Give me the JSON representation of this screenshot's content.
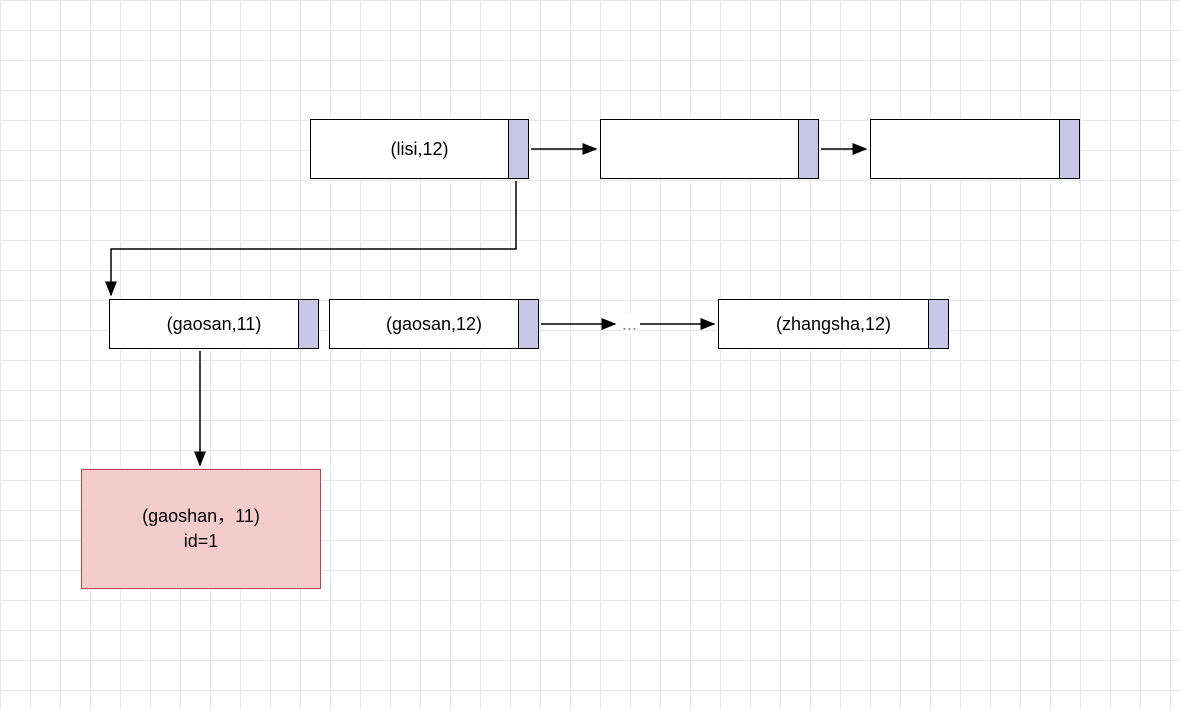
{
  "diagram": {
    "top_row": {
      "node1": {
        "label": "(lisi,12)"
      },
      "node2": {
        "label": ""
      },
      "node3": {
        "label": ""
      }
    },
    "mid_row": {
      "node1": {
        "label": "(gaosan,11)"
      },
      "node2": {
        "label": "(gaosan,12)"
      },
      "ellipsis": "...",
      "node3": {
        "label": "(zhangsha,12)"
      }
    },
    "result": {
      "line1": "(gaoshan，11)",
      "line2": "id=1"
    }
  },
  "colors": {
    "grid_line": "#e8e8e8",
    "node_fill": "#ffffff",
    "node_border": "#000000",
    "handle_fill": "#c7c7e8",
    "result_fill": "#f4cccc",
    "result_border": "#b54949"
  }
}
